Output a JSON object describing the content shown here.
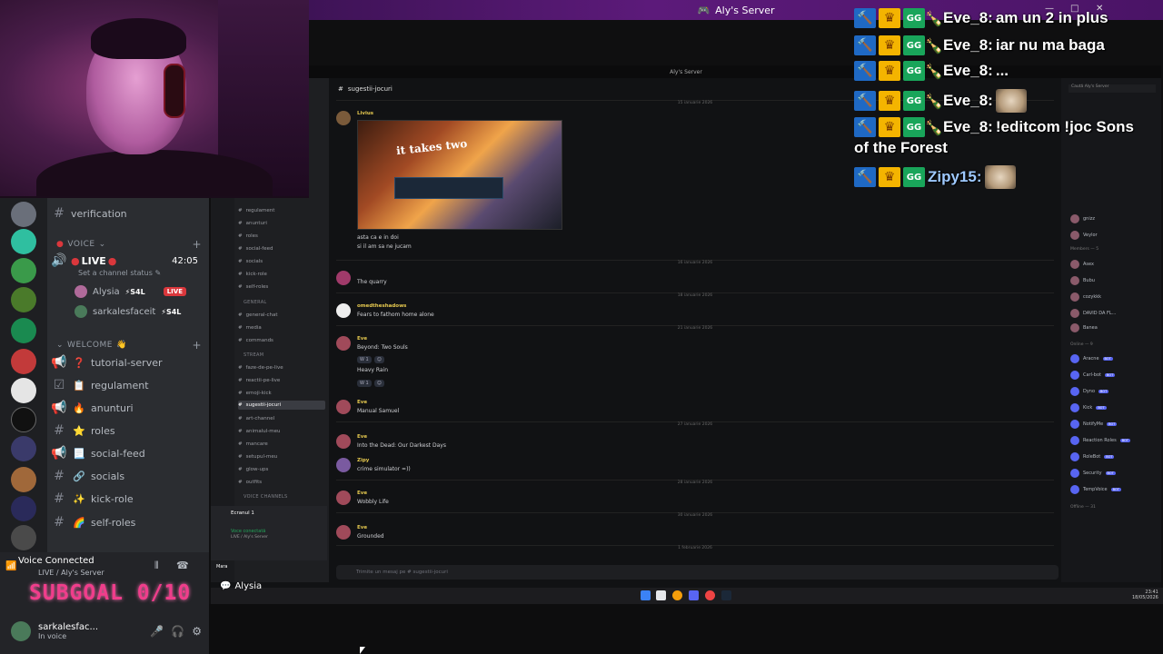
{
  "window": {
    "title": "Aly's Server",
    "inner_title": "Aly's Server"
  },
  "overlay_chat": [
    {
      "user": "Eve_8",
      "text": "am un 2 in plus"
    },
    {
      "user": "Eve_8",
      "text": "iar nu ma baga"
    },
    {
      "user": "Eve_8",
      "text": "..."
    },
    {
      "user": "Eve_8",
      "text": "",
      "emote": "cat-emote"
    },
    {
      "user": "Eve_8",
      "text": "!editcom !joc Sons",
      "text2": "of the Forest"
    },
    {
      "user": "Zipy15",
      "text": "",
      "emote": "cat-emote"
    }
  ],
  "sidebar": {
    "channels_top": [
      {
        "icon": "#",
        "label": "verification"
      }
    ],
    "voice_category": "VOICE",
    "live_channel": {
      "label": "LIVE",
      "timer": "42:05",
      "status": "Set a channel status"
    },
    "voice_users": [
      {
        "name": "Alysia",
        "tag": "S4L",
        "badge": "LIVE"
      },
      {
        "name": "sarkalesfaceit",
        "tag": "S4L"
      }
    ],
    "welcome_category": "WELCOME",
    "channels": [
      {
        "icon": "📢",
        "emoji": "❓",
        "label": "tutorial-server"
      },
      {
        "icon": "☑",
        "emoji": "📋",
        "label": "regulament"
      },
      {
        "icon": "📢",
        "emoji": "🔥",
        "label": "anunturi"
      },
      {
        "icon": "#",
        "emoji": "⭐",
        "label": "roles"
      },
      {
        "icon": "📢",
        "emoji": "📃",
        "label": "social-feed"
      },
      {
        "icon": "#",
        "emoji": "🔗",
        "label": "socials"
      },
      {
        "icon": "#",
        "emoji": "✨",
        "label": "kick-role"
      },
      {
        "icon": "#",
        "emoji": "🌈",
        "label": "self-roles"
      }
    ]
  },
  "voice_panel": {
    "title": "Voice Connected",
    "subtitle": "LIVE / Aly's Server",
    "user": "sarkalesfac...",
    "user_status": "In voice",
    "subgoal": "SUBGOAL 0/10"
  },
  "inner": {
    "channel": "sugestii-jocuri",
    "categories": [
      "GENERAL",
      "STREAM",
      "VOICE CHANNELS"
    ],
    "channels": [
      "regulament",
      "anunturi",
      "roles",
      "social-feed",
      "socials",
      "kick-role",
      "self-roles",
      "general-chat",
      "media",
      "commands",
      "faze-de-pe-live",
      "reactii-pe-live",
      "emoji-kick",
      "sugestii-jocuri",
      "art-channel",
      "animalul-meu",
      "mancare",
      "setupul-meu",
      "glow-ups",
      "outfits"
    ],
    "messages": [
      {
        "name": "Livius",
        "text": ""
      },
      {
        "name": "",
        "text": "asta ca e in doi"
      },
      {
        "name": "",
        "text": "si il am sa ne jucam"
      },
      {
        "name": "",
        "text": "The quarry"
      },
      {
        "name": "omedtheshadows",
        "text": "Fears to fathom home alone"
      },
      {
        "name": "Eve",
        "text": "Beyond: Two Souls"
      },
      {
        "name": "",
        "text": "Heavy Rain"
      },
      {
        "name": "Eve",
        "text": "Manual Samuel"
      },
      {
        "name": "Eve",
        "text": "Into the Dead: Our Darkest Days"
      },
      {
        "name": "Zipy",
        "text": "crime simulator =))"
      },
      {
        "name": "Eve",
        "text": "Wobbly Life"
      },
      {
        "name": "Eve",
        "text": "Grounded"
      }
    ],
    "dates": [
      "15 ianuarie 2026",
      "16 ianuarie 2026",
      "18 ianuarie 2026",
      "21 ianuarie 2026",
      "27 ianuarie 2026",
      "28 ianuarie 2026",
      "30 ianuarie 2026",
      "1 februarie 2026"
    ],
    "game_logo": "it takes two",
    "composer": "Trimite un mesaj pe # sugestii-jocuri",
    "voice_bar": {
      "title": "Ecranul 1",
      "status": "Voce conectată",
      "server": "LIVE / Aly's Server"
    },
    "self_user": "Mara",
    "members": [
      {
        "name": "Aracne",
        "bot": "BOT"
      },
      {
        "name": "Carl-bot",
        "bot": "BOT"
      },
      {
        "name": "Dyno",
        "bot": "BOT"
      },
      {
        "name": "Kick",
        "bot": "BOT"
      },
      {
        "name": "NotifyMe",
        "bot": "BOT"
      },
      {
        "name": "Reaction Roles",
        "bot": "BOT"
      },
      {
        "name": "RoleBot",
        "bot": "BOT"
      },
      {
        "name": "Security",
        "bot": "BOT"
      },
      {
        "name": "TempVoice",
        "bot": "BOT"
      }
    ],
    "members_top": [
      "gnizz",
      "Veylor",
      "Asex",
      "Bubu",
      "cozykkk",
      "DAVID DA FL...",
      "Banea"
    ],
    "member_cats": [
      "Members — 5",
      "Online — 9",
      "Offline — 31"
    ],
    "search": "Caută Aly's Server",
    "clock": {
      "time": "23:41",
      "date": "18/05/2026"
    }
  },
  "streamer_tag": "Alysia",
  "colors": {
    "accent": "#5865f2",
    "live": "#da373c",
    "subgoal": "#f03d8b"
  }
}
